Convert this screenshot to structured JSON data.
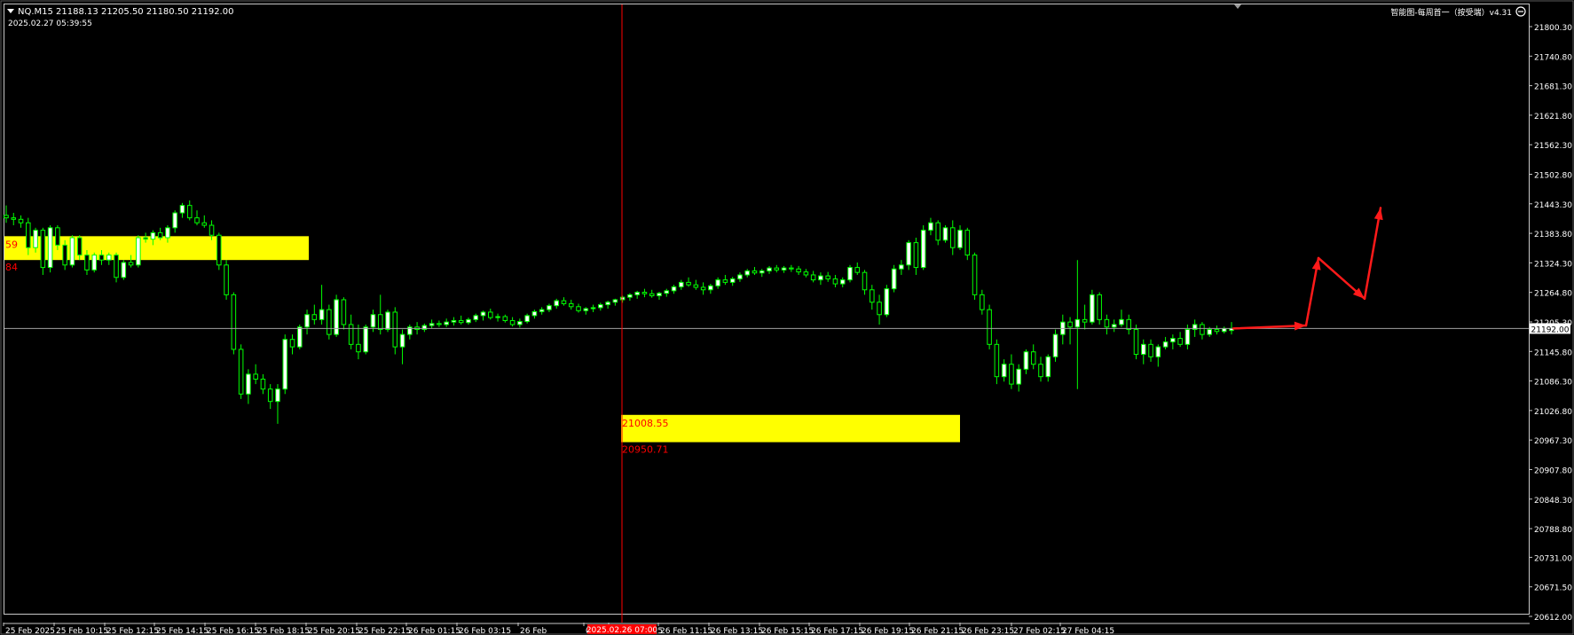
{
  "header": {
    "symbol_line": "NQ.M15  21188.13 21205.50 21180.50 21192.00",
    "datetime": "2025.02.27 05:39:55",
    "indicator": "智能图-每周首一（按受端）v4.31"
  },
  "colors": {
    "background": "#000000",
    "bull_body": "#ffffff",
    "bear_body": "#000000",
    "wick": "#00ff00",
    "zone": "#ffff00",
    "zone_text": "#ff0000",
    "crosshair": "#ff0000",
    "price_line": "#a0a0a0",
    "arrow": "#ff1a1a",
    "axis_text": "#ffffff"
  },
  "chart_data": {
    "type": "candlestick",
    "timeframe": "M15",
    "symbol": "NQ.M15",
    "ylim": [
      20600,
      21830
    ],
    "y_ticks": [
      "21800.30",
      "21740.80",
      "21681.30",
      "21621.80",
      "21562.30",
      "21502.80",
      "21443.30",
      "21383.80",
      "21324.30",
      "21264.80",
      "21205.30",
      "21145.80",
      "21086.30",
      "21026.80",
      "20967.30",
      "20907.80",
      "20848.30",
      "20788.80",
      "20731.00",
      "20671.50",
      "20612.00"
    ],
    "x_ticks": [
      "25 Feb 2025",
      "25 Feb 10:15",
      "25 Feb 12:15",
      "25 Feb 14:15",
      "25 Feb 16:15",
      "25 Feb 18:15",
      "25 Feb 20:15",
      "25 Feb 22:15",
      "26 Feb 01:15",
      "26 Feb 03:15",
      "26 Feb",
      "07:15",
      "26 Feb 09:15",
      "26 Feb 11:15",
      "26 Feb 13:15",
      "26 Feb 15:15",
      "26 Feb 17:15",
      "26 Feb 19:15",
      "26 Feb 21:15",
      "26 Feb 23:15",
      "27 Feb 02:15",
      "27 Feb 04:15"
    ],
    "current_price": "21192.00",
    "crosshair_time": "2025.02.26 07:00",
    "zones": [
      {
        "top": 21378,
        "bottom": 21330,
        "labels": [
          "59",
          "84"
        ]
      },
      {
        "top": 21018,
        "bottom": 20963,
        "labels": [
          "21008.55",
          "20950.71"
        ]
      }
    ],
    "projection_path": [
      21192,
      21198,
      21334,
      21252,
      21435
    ],
    "candles": [
      [
        21420,
        21440,
        21405,
        21415
      ],
      [
        21415,
        21425,
        21400,
        21412
      ],
      [
        21412,
        21420,
        21395,
        21405
      ],
      [
        21405,
        21415,
        21340,
        21355
      ],
      [
        21355,
        21395,
        21345,
        21390
      ],
      [
        21390,
        21395,
        21300,
        21315
      ],
      [
        21315,
        21400,
        21305,
        21395
      ],
      [
        21395,
        21400,
        21350,
        21360
      ],
      [
        21360,
        21370,
        21310,
        21320
      ],
      [
        21320,
        21380,
        21315,
        21375
      ],
      [
        21375,
        21380,
        21330,
        21340
      ],
      [
        21340,
        21350,
        21300,
        21310
      ],
      [
        21310,
        21345,
        21305,
        21340
      ],
      [
        21340,
        21350,
        21320,
        21330
      ],
      [
        21330,
        21345,
        21320,
        21340
      ],
      [
        21340,
        21345,
        21285,
        21295
      ],
      [
        21295,
        21330,
        21290,
        21325
      ],
      [
        21325,
        21340,
        21315,
        21320
      ],
      [
        21320,
        21380,
        21315,
        21375
      ],
      [
        21375,
        21385,
        21365,
        21372
      ],
      [
        21372,
        21390,
        21360,
        21385
      ],
      [
        21385,
        21395,
        21370,
        21375
      ],
      [
        21375,
        21400,
        21365,
        21395
      ],
      [
        21395,
        21430,
        21385,
        21425
      ],
      [
        21425,
        21445,
        21415,
        21440
      ],
      [
        21440,
        21450,
        21410,
        21415
      ],
      [
        21415,
        21430,
        21400,
        21405
      ],
      [
        21405,
        21420,
        21395,
        21400
      ],
      [
        21400,
        21410,
        21370,
        21380
      ],
      [
        21380,
        21385,
        21310,
        21320
      ],
      [
        21320,
        21330,
        21250,
        21260
      ],
      [
        21260,
        21265,
        21140,
        21150
      ],
      [
        21150,
        21160,
        21050,
        21060
      ],
      [
        21060,
        21110,
        21040,
        21100
      ],
      [
        21100,
        21120,
        21080,
        21090
      ],
      [
        21090,
        21100,
        21060,
        21070
      ],
      [
        21070,
        21080,
        21030,
        21045
      ],
      [
        21045,
        21080,
        21000,
        21070
      ],
      [
        21070,
        21180,
        21060,
        21170
      ],
      [
        21170,
        21180,
        21140,
        21155
      ],
      [
        21155,
        21200,
        21150,
        21195
      ],
      [
        21195,
        21230,
        21180,
        21220
      ],
      [
        21220,
        21240,
        21200,
        21210
      ],
      [
        21210,
        21280,
        21200,
        21230
      ],
      [
        21230,
        21240,
        21170,
        21180
      ],
      [
        21180,
        21260,
        21175,
        21250
      ],
      [
        21250,
        21255,
        21190,
        21200
      ],
      [
        21200,
        21220,
        21150,
        21160
      ],
      [
        21160,
        21200,
        21130,
        21145
      ],
      [
        21145,
        21200,
        21140,
        21195
      ],
      [
        21195,
        21230,
        21185,
        21220
      ],
      [
        21220,
        21260,
        21180,
        21190
      ],
      [
        21190,
        21230,
        21185,
        21225
      ],
      [
        21225,
        21235,
        21140,
        21155
      ],
      [
        21155,
        21190,
        21120,
        21180
      ],
      [
        21180,
        21200,
        21170,
        21195
      ],
      [
        21195,
        21205,
        21180,
        21190
      ],
      [
        21190,
        21202,
        21185,
        21198
      ],
      [
        21198,
        21210,
        21192,
        21202
      ],
      [
        21202,
        21208,
        21195,
        21200
      ],
      [
        21200,
        21212,
        21195,
        21205
      ],
      [
        21205,
        21215,
        21198,
        21208
      ],
      [
        21208,
        21218,
        21200,
        21204
      ],
      [
        21204,
        21214,
        21200,
        21210
      ],
      [
        21210,
        21222,
        21205,
        21218
      ],
      [
        21218,
        21228,
        21208,
        21225
      ],
      [
        21225,
        21232,
        21210,
        21214
      ],
      [
        21214,
        21222,
        21206,
        21216
      ],
      [
        21216,
        21220,
        21204,
        21208
      ],
      [
        21208,
        21215,
        21196,
        21200
      ],
      [
        21200,
        21212,
        21194,
        21206
      ],
      [
        21206,
        21222,
        21202,
        21218
      ],
      [
        21218,
        21230,
        21212,
        21226
      ],
      [
        21226,
        21235,
        21220,
        21230
      ],
      [
        21230,
        21242,
        21225,
        21238
      ],
      [
        21238,
        21252,
        21232,
        21248
      ],
      [
        21248,
        21255,
        21238,
        21242
      ],
      [
        21242,
        21250,
        21230,
        21236
      ],
      [
        21236,
        21242,
        21224,
        21228
      ],
      [
        21228,
        21235,
        21220,
        21232
      ],
      [
        21232,
        21240,
        21225,
        21234
      ],
      [
        21234,
        21244,
        21228,
        21240
      ],
      [
        21240,
        21248,
        21232,
        21245
      ],
      [
        21245,
        21252,
        21238,
        21250
      ],
      [
        21250,
        21258,
        21244,
        21255
      ],
      [
        21255,
        21263,
        21248,
        21260
      ],
      [
        21260,
        21268,
        21252,
        21265
      ],
      [
        21265,
        21272,
        21255,
        21262
      ],
      [
        21262,
        21270,
        21254,
        21258
      ],
      [
        21258,
        21266,
        21250,
        21263
      ],
      [
        21263,
        21272,
        21256,
        21268
      ],
      [
        21268,
        21280,
        21262,
        21276
      ],
      [
        21276,
        21290,
        21270,
        21285
      ],
      [
        21285,
        21295,
        21276,
        21280
      ],
      [
        21280,
        21290,
        21270,
        21275
      ],
      [
        21275,
        21285,
        21260,
        21270
      ],
      [
        21270,
        21282,
        21262,
        21278
      ],
      [
        21278,
        21295,
        21272,
        21290
      ],
      [
        21290,
        21300,
        21280,
        21285
      ],
      [
        21285,
        21296,
        21278,
        21292
      ],
      [
        21292,
        21305,
        21286,
        21300
      ],
      [
        21300,
        21312,
        21295,
        21308
      ],
      [
        21308,
        21316,
        21300,
        21304
      ],
      [
        21304,
        21312,
        21296,
        21308
      ],
      [
        21308,
        21318,
        21302,
        21314
      ],
      [
        21314,
        21320,
        21305,
        21310
      ],
      [
        21310,
        21318,
        21304,
        21314
      ],
      [
        21314,
        21320,
        21306,
        21312
      ],
      [
        21312,
        21318,
        21300,
        21306
      ],
      [
        21306,
        21312,
        21295,
        21300
      ],
      [
        21300,
        21308,
        21285,
        21290
      ],
      [
        21290,
        21305,
        21280,
        21298
      ],
      [
        21298,
        21306,
        21286,
        21292
      ],
      [
        21292,
        21300,
        21275,
        21282
      ],
      [
        21282,
        21295,
        21275,
        21290
      ],
      [
        21290,
        21320,
        21285,
        21315
      ],
      [
        21315,
        21325,
        21300,
        21305
      ],
      [
        21305,
        21310,
        21260,
        21270
      ],
      [
        21270,
        21280,
        21230,
        21245
      ],
      [
        21245,
        21260,
        21200,
        21220
      ],
      [
        21220,
        21280,
        21215,
        21272
      ],
      [
        21272,
        21320,
        21265,
        21312
      ],
      [
        21312,
        21330,
        21300,
        21320
      ],
      [
        21320,
        21370,
        21310,
        21365
      ],
      [
        21365,
        21375,
        21300,
        21315
      ],
      [
        21315,
        21400,
        21310,
        21390
      ],
      [
        21390,
        21415,
        21380,
        21405
      ],
      [
        21405,
        21410,
        21360,
        21370
      ],
      [
        21370,
        21400,
        21365,
        21395
      ],
      [
        21395,
        21410,
        21340,
        21355
      ],
      [
        21355,
        21400,
        21350,
        21390
      ],
      [
        21390,
        21395,
        21330,
        21340
      ],
      [
        21340,
        21345,
        21250,
        21260
      ],
      [
        21260,
        21270,
        21220,
        21230
      ],
      [
        21230,
        21240,
        21150,
        21160
      ],
      [
        21160,
        21170,
        21080,
        21095
      ],
      [
        21095,
        21130,
        21085,
        21120
      ],
      [
        21120,
        21140,
        21070,
        21080
      ],
      [
        21080,
        21120,
        21065,
        21110
      ],
      [
        21110,
        21150,
        21100,
        21145
      ],
      [
        21145,
        21160,
        21110,
        21120
      ],
      [
        21120,
        21135,
        21085,
        21095
      ],
      [
        21095,
        21140,
        21085,
        21135
      ],
      [
        21135,
        21190,
        21125,
        21180
      ],
      [
        21180,
        21220,
        21160,
        21205
      ],
      [
        21205,
        21215,
        21160,
        21195
      ],
      [
        21195,
        21330,
        21070,
        21210
      ],
      [
        21210,
        21240,
        21190,
        21205
      ],
      [
        21205,
        21270,
        21200,
        21260
      ],
      [
        21260,
        21265,
        21200,
        21210
      ],
      [
        21210,
        21220,
        21180,
        21195
      ],
      [
        21195,
        21210,
        21185,
        21200
      ],
      [
        21200,
        21230,
        21195,
        21210
      ],
      [
        21210,
        21220,
        21180,
        21190
      ],
      [
        21190,
        21200,
        21130,
        21140
      ],
      [
        21140,
        21170,
        21120,
        21160
      ],
      [
        21160,
        21170,
        21125,
        21135
      ],
      [
        21135,
        21160,
        21115,
        21155
      ],
      [
        21155,
        21175,
        21150,
        21165
      ],
      [
        21165,
        21180,
        21150,
        21172
      ],
      [
        21172,
        21185,
        21155,
        21160
      ],
      [
        21160,
        21200,
        21150,
        21190
      ],
      [
        21190,
        21210,
        21175,
        21200
      ],
      [
        21200,
        21205,
        21170,
        21180
      ],
      [
        21180,
        21195,
        21175,
        21190
      ],
      [
        21190,
        21198,
        21180,
        21186
      ],
      [
        21186,
        21196,
        21182,
        21192
      ],
      [
        21188,
        21205,
        21180,
        21192
      ]
    ]
  }
}
